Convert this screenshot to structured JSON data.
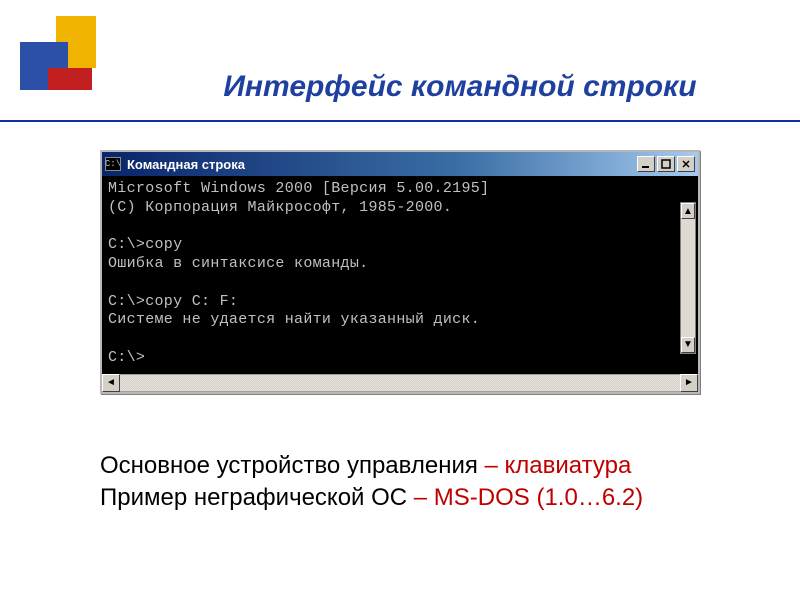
{
  "decor": {
    "colors": {
      "blue": "#2c4fa8",
      "gold": "#f0b400",
      "red": "#c22020"
    }
  },
  "title": "Интерфейс командной строки",
  "window": {
    "icon_text": "C:\\",
    "title": "Командная строка",
    "buttons": {
      "minimize": "_",
      "maximize": "□",
      "close": "×"
    },
    "terminal_lines": [
      "Microsoft Windows 2000 [Версия 5.00.2195]",
      "(C) Корпорация Майкрософт, 1985-2000.",
      "",
      "C:\\>copy",
      "Ошибка в синтаксисе команды.",
      "",
      "C:\\>copy C: F:",
      "Системе не удается найти указанный диск.",
      "",
      "C:\\>"
    ],
    "scroll": {
      "left": "◄",
      "right": "►",
      "up": "▲",
      "down": "▼"
    }
  },
  "caption": {
    "line1_black": "Основное устройство управления ",
    "line1_red": "– клавиатура",
    "line2_black": "Пример неграфической ОС ",
    "line2_red": "– MS-DOS (1.0…6.2)"
  }
}
